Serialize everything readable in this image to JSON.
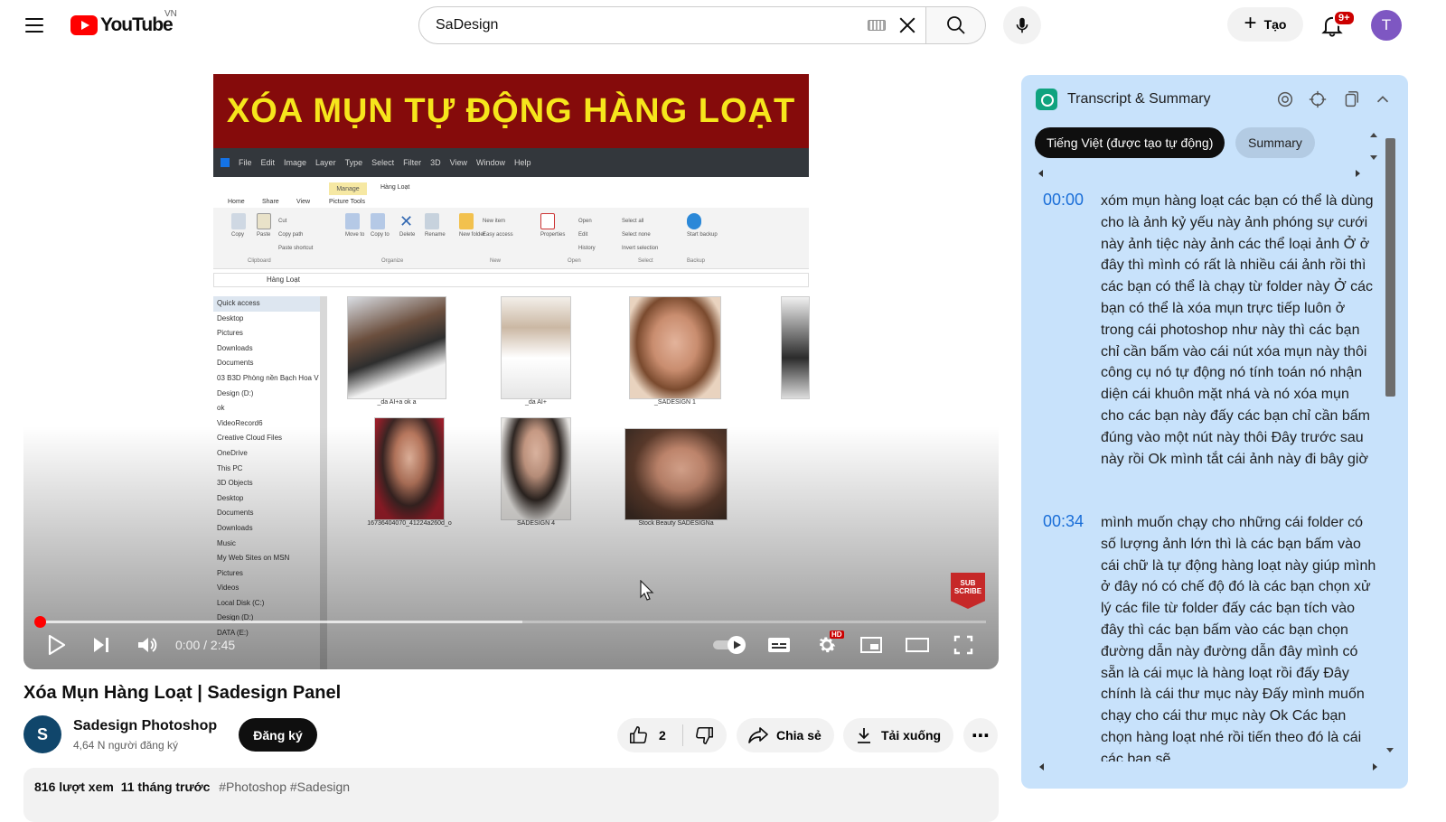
{
  "masthead": {
    "logo_text": "YouTube",
    "country_code": "VN",
    "search_value": "SaDesign",
    "create_label": "Tạo",
    "notification_count": "9+",
    "avatar_letter": "T"
  },
  "player": {
    "banner_text": "XÓA MỤN TỰ ĐỘNG HÀNG LOẠT",
    "ps_menu": [
      "File",
      "Edit",
      "Image",
      "Layer",
      "Type",
      "Select",
      "Filter",
      "3D",
      "View",
      "Window",
      "Help"
    ],
    "explorer": {
      "manage_tab": "Manage",
      "folder_title": "Hàng Loạt",
      "tabs": [
        "Home",
        "Share",
        "View",
        "Picture Tools"
      ],
      "address": "Hàng Loạt",
      "ribbon_groups": [
        "Clipboard",
        "Organize",
        "New",
        "Open",
        "Select",
        "Backup"
      ],
      "ribbon_buttons": [
        "Copy",
        "Paste",
        "Move to",
        "Copy to",
        "Delete",
        "Rename",
        "New folder",
        "Properties",
        "Start backup"
      ],
      "ribbon_small": [
        "Cut",
        "Copy path",
        "Paste shortcut",
        "New item",
        "Easy access",
        "Open",
        "Edit",
        "History",
        "Select all",
        "Select none",
        "Invert selection"
      ],
      "nav_items": [
        "Quick access",
        "Desktop",
        "Pictures",
        "Downloads",
        "Documents",
        "03 B3D Phòng nền Bạch Hoa V",
        "Design (D:)",
        "ok",
        "VideoRecord6",
        "Creative Cloud Files",
        "OneDrive",
        "This PC",
        "3D Objects",
        "Desktop",
        "Documents",
        "Downloads",
        "Music",
        "My Web Sites on MSN",
        "Pictures",
        "Videos",
        "Local Disk (C:)",
        "Design (D:)",
        "DATA (E:)"
      ],
      "thumbnails": [
        "_da AI+a ok a",
        "_da AI+",
        "_SADESIGN 1",
        "16736404070_41224a260d_o",
        "SADESIGN 4",
        "Stock Beauty SADESIGNa"
      ]
    },
    "subscribe_badge": "SUB SCRIBE",
    "time_display": "0:00 / 2:45",
    "progress_played": 0,
    "progress_buffered": 0.51,
    "settings_badge": "HD"
  },
  "video": {
    "title": "Xóa Mụn Hàng Loạt | Sadesign Panel",
    "channel_name": "Sadesign Photoshop",
    "channel_initial": "S",
    "subscribers": "4,64 N người đăng ký",
    "subscribe_label": "Đăng ký",
    "like_count": "2",
    "share_label": "Chia sẻ",
    "download_label": "Tải xuống",
    "more_label": "⋯",
    "views": "816 lượt xem",
    "age": "11 tháng trước",
    "hashtags": "#Photoshop #Sadesign"
  },
  "transcript_panel": {
    "title": "Transcript & Summary",
    "language_button": "Tiếng Việt (được tạo tự động)",
    "summary_button": "Summary",
    "segments": [
      {
        "time": "00:00",
        "text": "xóm mụn hàng loạt các bạn có thể là dùng cho là ảnh kỷ yếu này ảnh phóng sự cưới này ảnh tiệc này ảnh các thể loại ảnh Ở ở đây thì mình có rất là nhiều cái ảnh rồi thì các bạn có thể là chạy từ folder này Ở các bạn có thể là xóa mụn trực tiếp luôn ở trong cái photoshop như này thì các bạn chỉ cần bấm vào cái nút xóa mụn này thôi công cụ nó tự động nó tính toán nó nhận diện cái khuôn mặt nhá và nó xóa mụn cho các bạn này đấy các bạn chỉ cần bấm đúng vào một nút này thôi Đây trước sau này rồi Ok mình tắt cái ảnh này đi bây giờ"
      },
      {
        "time": "00:34",
        "text": "mình muốn chạy cho những cái folder có số lượng ảnh lớn thì là các bạn bấm vào cái chữ là tự động hàng loạt này giúp mình ở đây nó có chế độ đó là các bạn chọn xử lý các file từ folder đấy các bạn tích vào đây thì các bạn bấm vào các bạn chọn đường dẫn này đường dẫn đây mình có sẵn là cái mục là hàng loạt rồi đấy Đây chính là cái thư mục này Đấy mình muốn chạy cho cái thư mục này Ok Các bạn chọn hàng loạt nhé rồi tiến theo đó là cái các bạn sẽ"
      }
    ]
  },
  "colors": {
    "brand_red": "#ff0000",
    "panel_bg": "#c8e2fb",
    "timestamp_blue": "#1a6ed8",
    "banner_bg": "#850b0b",
    "banner_text": "#f6e61c"
  }
}
